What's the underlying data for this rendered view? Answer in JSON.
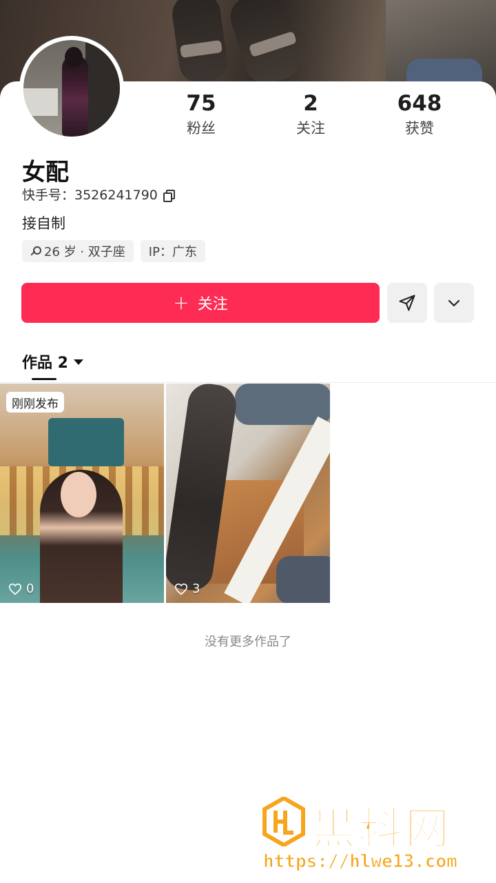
{
  "profile": {
    "name": "女配",
    "kuaishou_id": "快手号：3526241790",
    "bio": "接自制",
    "tags": {
      "age_sign": "26 岁 · 双子座",
      "ip": "IP：广东"
    }
  },
  "stats": [
    {
      "value": "75",
      "label": "粉丝"
    },
    {
      "value": "2",
      "label": "关注"
    },
    {
      "value": "648",
      "label": "获赞"
    }
  ],
  "actions": {
    "follow_label": "关注",
    "accent_color": "#fe2c55"
  },
  "tabs": {
    "works_label": "作品 2"
  },
  "works": [
    {
      "badge": "刚刚发布",
      "likes": "0"
    },
    {
      "badge": "",
      "likes": "3"
    }
  ],
  "footer": {
    "no_more_text": "没有更多作品了"
  },
  "watermark": {
    "title": "黑料网",
    "url": "https://hlwe13.com",
    "color": "#f7a51c"
  }
}
